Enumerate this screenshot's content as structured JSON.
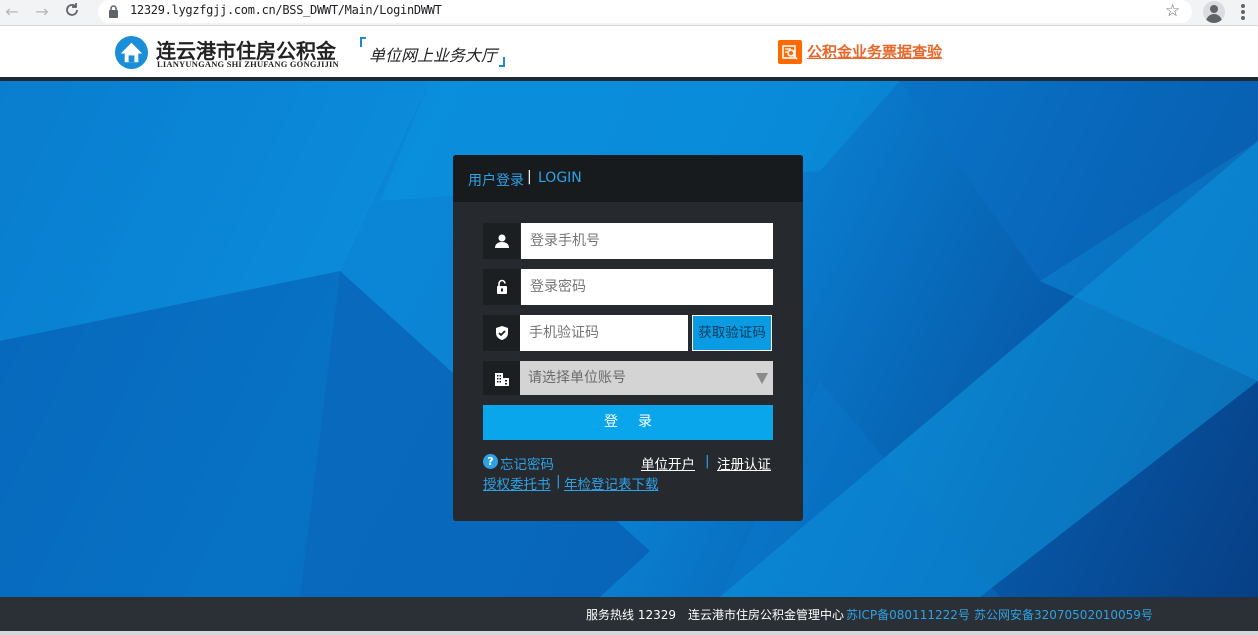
{
  "browser": {
    "url": "12329.lygzfgjj.com.cn/BSS_DWWT/Main/LoginDWWT",
    "icons": [
      "back-arrow-icon",
      "forward-arrow-icon",
      "reload-icon",
      "lock-icon",
      "star-icon",
      "avatar-icon",
      "menu-dots-icon"
    ]
  },
  "header": {
    "logo_cn": "连云港市住房公积金",
    "logo_en": "LIANYUNGANG SHI ZHUFANG GONGJIJIN",
    "hall_title": "单位网上业务大厅",
    "check_link": "公积金业务票据查验",
    "accent": "#1e88d3",
    "check_color": "#e8672a"
  },
  "login": {
    "title": "用户登录",
    "separator": "|",
    "title_en": "LOGIN",
    "phone_placeholder": "登录手机号",
    "password_placeholder": "登录密码",
    "code_placeholder": "手机验证码",
    "get_code_label": "获取验证码",
    "unit_select_value": "请选择单位账号",
    "login_button": "登录",
    "help_glyph": "?",
    "forgot_password": "忘记密码",
    "open_account": "单位开户",
    "links_separator": "|",
    "register": "注册认证",
    "authorization_letter": "授权委托书",
    "annual_download": "年检登记表下载",
    "button_color": "#0aa6ec",
    "panel_color": "#262a2e"
  },
  "footer": {
    "hotline": "服务热线 12329",
    "center": "连云港市住房公积金管理中心",
    "icp": "苏ICP备080111222号",
    "public_security": "苏公网安备32070502010059号"
  }
}
